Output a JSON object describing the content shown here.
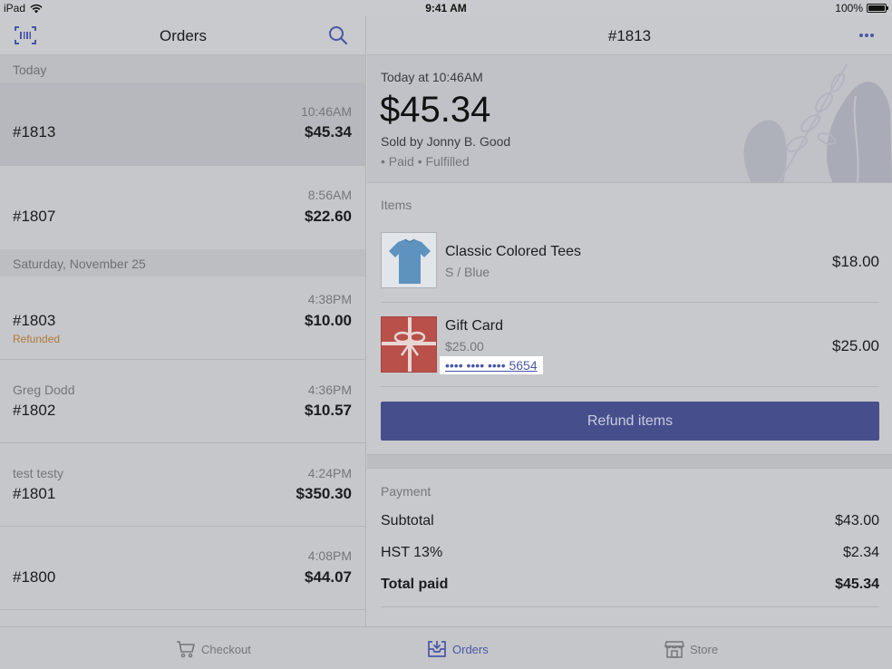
{
  "status_bar": {
    "device": "iPad",
    "time": "9:41 AM",
    "battery": "100%"
  },
  "orders_list": {
    "title": "Orders",
    "sections": [
      {
        "header": "Today"
      },
      {
        "header": "Saturday, November 25"
      }
    ],
    "orders": [
      {
        "number": "#1813",
        "time": "10:46AM",
        "amount": "$45.34",
        "customer": "",
        "status": ""
      },
      {
        "number": "#1807",
        "time": "8:56AM",
        "amount": "$22.60",
        "customer": "",
        "status": ""
      },
      {
        "number": "#1803",
        "time": "4:38PM",
        "amount": "$10.00",
        "customer": "",
        "status": "Refunded"
      },
      {
        "number": "#1802",
        "time": "4:36PM",
        "amount": "$10.57",
        "customer": "Greg Dodd",
        "status": ""
      },
      {
        "number": "#1801",
        "time": "4:24PM",
        "amount": "$350.30",
        "customer": "test testy",
        "status": ""
      },
      {
        "number": "#1800",
        "time": "4:08PM",
        "amount": "$44.07",
        "customer": "",
        "status": ""
      }
    ]
  },
  "order_detail": {
    "title": "#1813",
    "date": "Today at 10:46AM",
    "total_amount": "$45.34",
    "sold_by": "Sold by Jonny B. Good",
    "statuses": "• Paid • Fulfilled",
    "items_label": "Items",
    "items": [
      {
        "name": "Classic Colored Tees",
        "variant": "S / Blue",
        "price": "$18.00"
      },
      {
        "name": "Gift Card",
        "variant": "$25.00",
        "price": "$25.00",
        "code": "•••• •••• •••• 5654"
      }
    ],
    "refund_label": "Refund items",
    "payment_label": "Payment",
    "payment": [
      {
        "label": "Subtotal",
        "value": "$43.00"
      },
      {
        "label": "HST 13%",
        "value": "$2.34"
      },
      {
        "label": "Total paid",
        "value": "$45.34"
      }
    ]
  },
  "tabs": [
    {
      "label": "Checkout",
      "icon": "cart-icon",
      "active": false
    },
    {
      "label": "Orders",
      "icon": "orders-tray-icon",
      "active": true
    },
    {
      "label": "Store",
      "icon": "store-icon",
      "active": false
    }
  ],
  "colors": {
    "accent": "#4a56a6",
    "refund_button": "#464f8c",
    "refunded_status": "#b07a3a",
    "gift_card_red": "#b9504a"
  }
}
